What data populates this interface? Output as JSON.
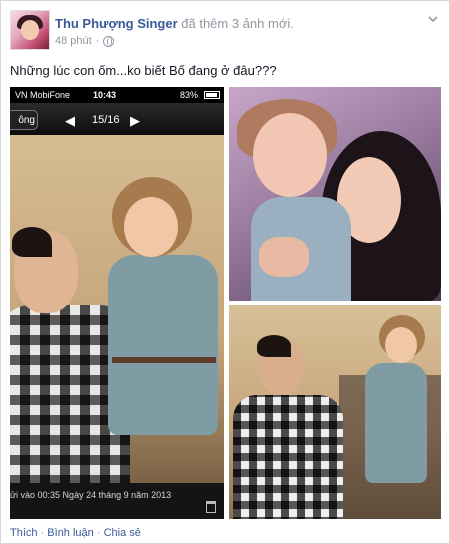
{
  "post": {
    "author": "Thu Phượng Singer",
    "action": " đã thêm 3 ảnh mới.",
    "time": "48 phút",
    "dot": "·",
    "text": "Những lúc con ốm...ko biết Bố đang ở đâu???"
  },
  "photo1": {
    "statusbar": {
      "carrier": "VN MobiFone",
      "time": "10:43",
      "battery": "83%"
    },
    "nav": {
      "back_label": "ông",
      "prev": "◀",
      "counter": "15/16",
      "next": "▶"
    },
    "caption": "ửi vào  00:35 Ngày 24 tháng 9 năm 2013"
  },
  "actions": {
    "like": "Thích",
    "comment": "Bình luận",
    "share": "Chia sẻ",
    "sep": " · "
  },
  "colors": {
    "link": "#3b5998",
    "meta": "#9197a3",
    "text": "#141823"
  },
  "icons": [
    "globe-icon",
    "chevron-down-icon",
    "battery-icon",
    "trash-icon",
    "wifi-icon"
  ]
}
